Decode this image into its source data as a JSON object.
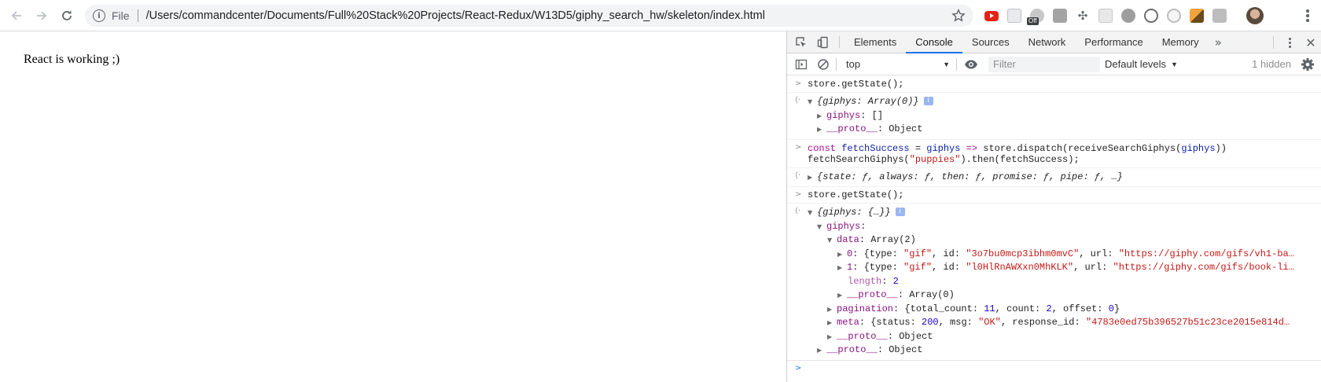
{
  "browser": {
    "url_scheme_label": "File",
    "url": "/Users/commandcenter/Documents/Full%20Stack%20Projects/React-Redux/W13D5/giphy_search_hw/skeleton/index.html",
    "ext_badge": "Off",
    "icons": [
      "back-arrow-icon",
      "forward-arrow-icon",
      "reload-icon",
      "info-icon",
      "star-icon",
      "youtube-icon",
      "extensions-puzzle-icon",
      "chrome-menu-icon"
    ]
  },
  "page": {
    "text": "React is working ;)"
  },
  "devtools": {
    "tabs": [
      "Elements",
      "Console",
      "Sources",
      "Network",
      "Performance",
      "Memory"
    ],
    "active_tab": "Console",
    "more_tabs": "»",
    "context": "top",
    "filter_placeholder": "Filter",
    "levels": "Default levels",
    "hidden": "1 hidden",
    "close": "✕"
  },
  "console": {
    "m1_cmd": "store.getState();",
    "m1_obj": "{giphys: Array(0)}",
    "m1_giphys_key": "giphys",
    "m1_giphys_val": ": []",
    "m1_proto_key": "__proto__",
    "m1_proto_val": ": Object",
    "m2_line1_a": "const ",
    "m2_line1_b": "fetchSuccess",
    "m2_line1_c": " = ",
    "m2_line1_d": "giphys",
    "m2_line1_e": " => ",
    "m2_line1_f": "store.dispatch(receiveSearchGiphys(",
    "m2_line1_g": "giphys",
    "m2_line1_h": "))",
    "m2_line2_a": "fetchSearchGiphys(",
    "m2_line2_b": "\"puppies\"",
    "m2_line2_c": ").then(fetchSuccess);",
    "m2_result": "{state: ƒ, always: ƒ, then: ƒ, promise: ƒ, pipe: ƒ, …}",
    "m3_cmd": "store.getState();",
    "m3_obj": "{giphys: {…}}",
    "m3_giphys_key": "giphys",
    "m3_giphys_val": ":",
    "m3_data_key": "data",
    "m3_data_val": ": Array(2)",
    "item0_key": "0",
    "item0_a": ": {type: ",
    "item0_type": "\"gif\"",
    "item0_b": ", id: ",
    "item0_id": "\"3o7bu0mcp3ibhm0mvC\"",
    "item0_c": ", url: ",
    "item0_url": "\"https://giphy.com/gifs/vh1-ba…",
    "item1_key": "1",
    "item1_a": ": {type: ",
    "item1_type": "\"gif\"",
    "item1_b": ", id: ",
    "item1_id": "\"l0HlRnAWXxn0MhKLK\"",
    "item1_c": ", url: ",
    "item1_url": "\"https://giphy.com/gifs/book-li…",
    "length_key": "length",
    "length_val": "2",
    "arr_proto_key": "__proto__",
    "arr_proto_val": ": Array(0)",
    "pag_key": "pagination",
    "pag_a": ": {total_count: ",
    "pag_total": "11",
    "pag_b": ", count: ",
    "pag_count": "2",
    "pag_c": ", offset: ",
    "pag_offset": "0",
    "pag_d": "}",
    "meta_key": "meta",
    "meta_a": ": {status: ",
    "meta_status": "200",
    "meta_b": ", msg: ",
    "meta_msg": "\"OK\"",
    "meta_c": ", response_id: ",
    "meta_rid": "\"4783e0ed75b396527b51c23ce2015e814d…",
    "g_proto_key": "__proto__",
    "g_proto_val": ": Object",
    "o_proto_key": "__proto__",
    "o_proto_val": ": Object"
  }
}
